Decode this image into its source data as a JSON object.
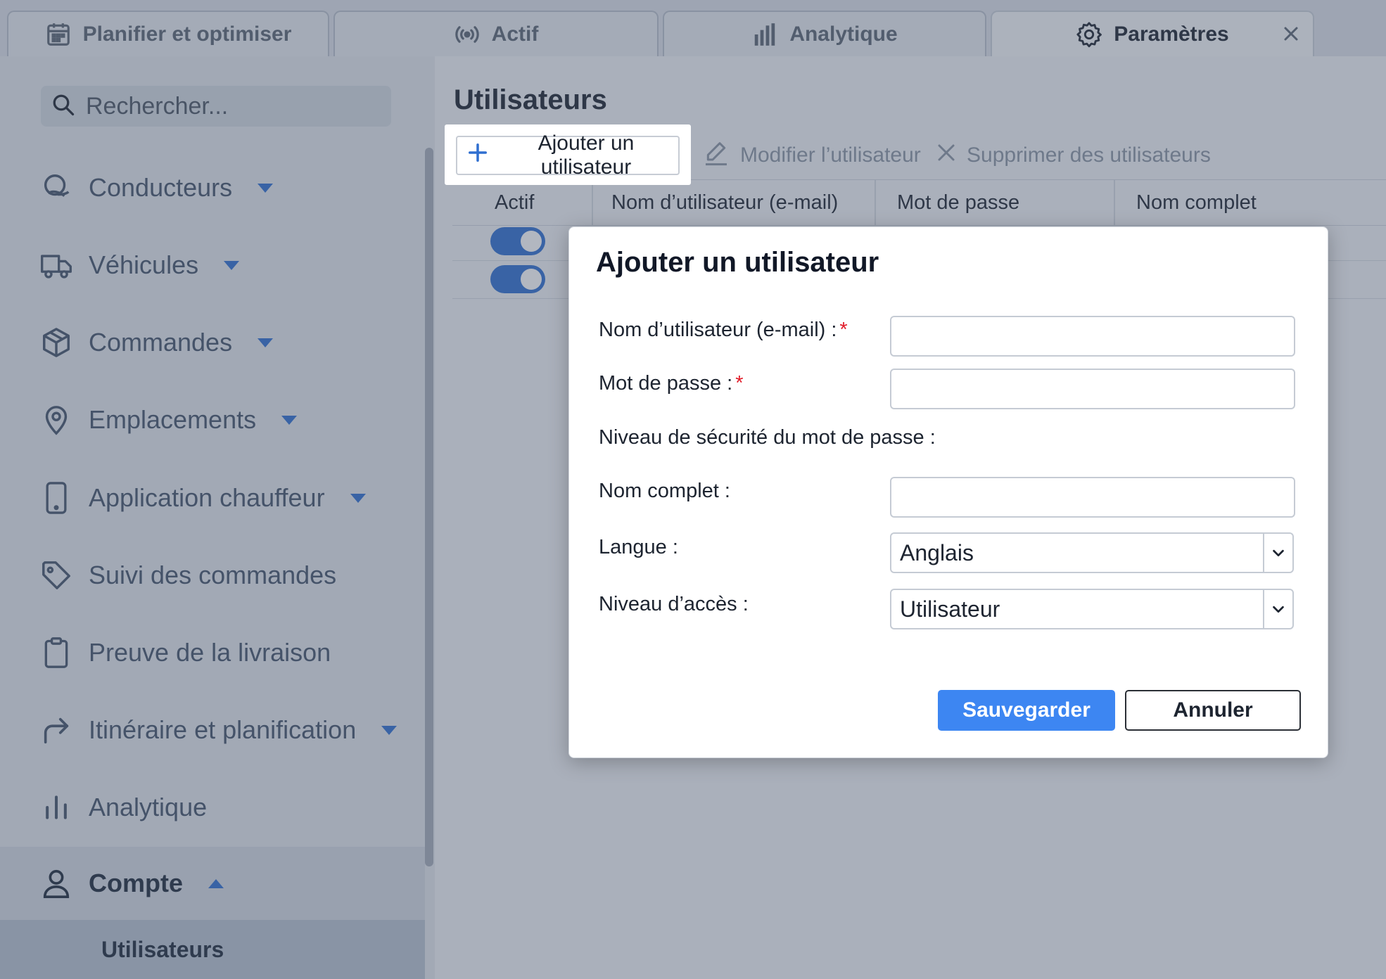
{
  "tabs": [
    {
      "label": "Planifier et optimiser",
      "icon": "calendar-icon"
    },
    {
      "label": "Actif",
      "icon": "broadcast-icon"
    },
    {
      "label": "Analytique",
      "icon": "bar-chart-icon"
    },
    {
      "label": "Paramètres",
      "icon": "gear-icon",
      "active": true
    }
  ],
  "sidebar": {
    "search_placeholder": "Rechercher...",
    "items": [
      {
        "label": "Conducteurs",
        "icon": "drivers-icon",
        "expandable": true
      },
      {
        "label": "Véhicules",
        "icon": "truck-icon",
        "expandable": true
      },
      {
        "label": "Commandes",
        "icon": "package-icon",
        "expandable": true
      },
      {
        "label": "Emplacements",
        "icon": "location-pin-icon",
        "expandable": true
      },
      {
        "label": "Application chauffeur",
        "icon": "phone-icon",
        "expandable": true
      },
      {
        "label": "Suivi des commandes",
        "icon": "tag-icon",
        "expandable": false
      },
      {
        "label": "Preuve de la livraison",
        "icon": "clipboard-icon",
        "expandable": false
      },
      {
        "label": "Itinéraire et planification",
        "icon": "route-arrow-icon",
        "expandable": true
      },
      {
        "label": "Analytique",
        "icon": "bar-chart-icon",
        "expandable": false
      },
      {
        "label": "Compte",
        "icon": "user-icon",
        "expanded": true
      }
    ],
    "subitem": "Utilisateurs"
  },
  "main": {
    "title": "Utilisateurs",
    "toolbar": {
      "add": "Ajouter un utilisateur",
      "edit": "Modifier l’utilisateur",
      "delete": "Supprimer des utilisateurs"
    },
    "columns": [
      "Actif",
      "Nom d’utilisateur (e-mail)",
      "Mot de passe",
      "Nom complet"
    ],
    "rows": [
      {
        "active": true
      },
      {
        "active": true
      }
    ]
  },
  "dialog": {
    "title": "Ajouter un utilisateur",
    "fields": {
      "username_label": "Nom d’utilisateur (e-mail) :",
      "password_label": "Mot de passe :",
      "strength_label": "Niveau de sécurité du mot de passe :",
      "fullname_label": "Nom complet :",
      "language_label": "Langue :",
      "language_value": "Anglais",
      "access_label": "Niveau d’accès :",
      "access_value": "Utilisateur",
      "required_marker": "*"
    },
    "save": "Sauvegarder",
    "cancel": "Annuler"
  },
  "colors": {
    "accent": "#2f6fd0",
    "primary_button": "#3d86f2",
    "required": "#e11d2a"
  }
}
